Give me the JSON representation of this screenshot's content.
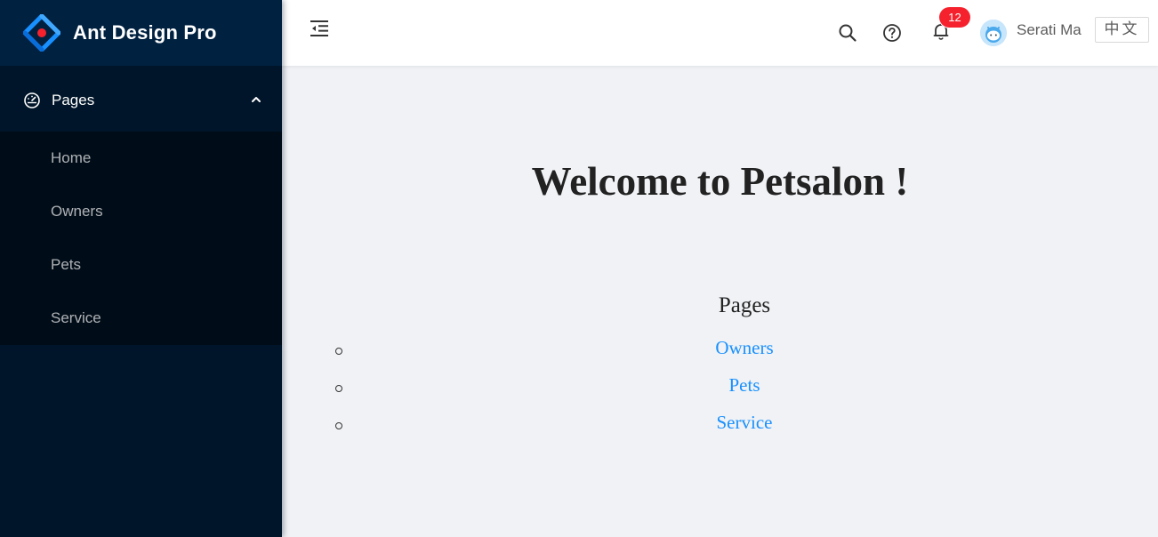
{
  "app": {
    "title": "Ant Design Pro"
  },
  "sidebar": {
    "group": {
      "label": "Pages",
      "icon": "dashboard-icon",
      "expanded": true
    },
    "items": [
      {
        "label": "Home"
      },
      {
        "label": "Owners"
      },
      {
        "label": "Pets"
      },
      {
        "label": "Service"
      }
    ]
  },
  "header": {
    "trigger_icon": "menu-fold-icon",
    "notification_count": "12",
    "user_name": "Serati Ma",
    "language_label": "中文"
  },
  "main": {
    "title": "Welcome to Petsalon !",
    "pages_heading": "Pages",
    "links": [
      "Owners",
      "Pets",
      "Service"
    ]
  },
  "colors": {
    "sider_bg": "#001529",
    "submenu_bg": "#000c17",
    "link": "#1890ff",
    "badge": "#f5222d",
    "content_bg": "#f0f2f5"
  }
}
